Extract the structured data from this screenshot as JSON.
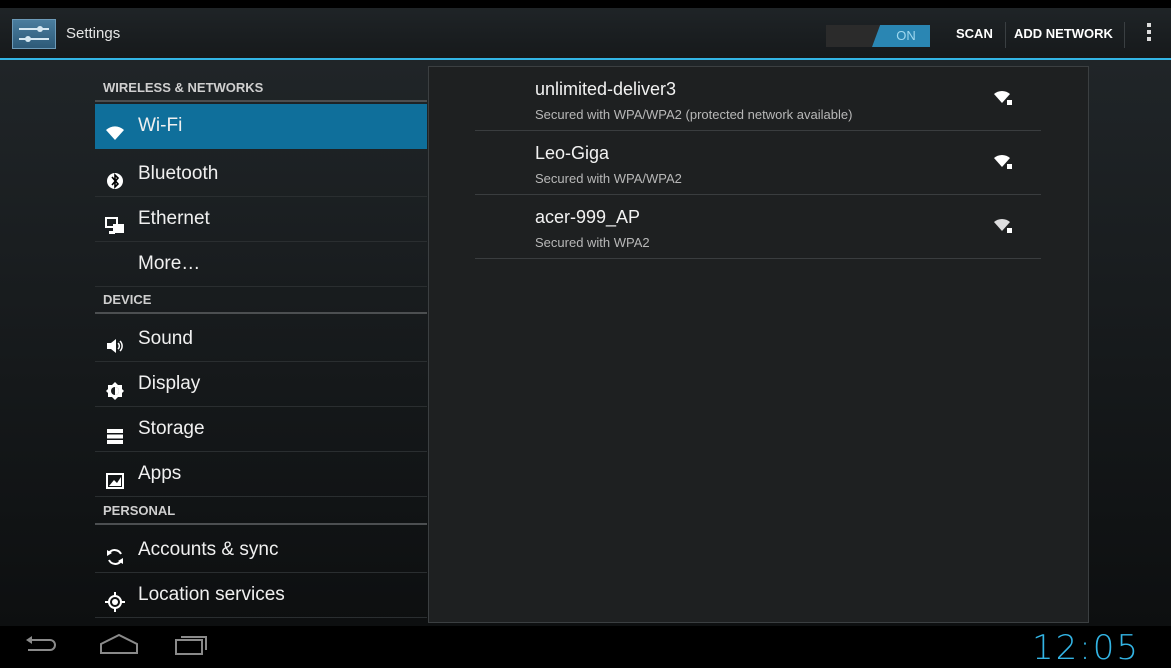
{
  "app": {
    "title": "Settings"
  },
  "actionbar": {
    "toggle_label": "ON",
    "scan_label": "SCAN",
    "add_network_label": "ADD NETWORK",
    "overflow_icon": "overflow-menu-icon",
    "accent": "#33b5e5"
  },
  "sidebar": {
    "sections": [
      {
        "title": "WIRELESS & NETWORKS"
      },
      {
        "title": "DEVICE"
      },
      {
        "title": "PERSONAL"
      }
    ],
    "items": [
      {
        "label": "Wi-Fi",
        "icon": "wifi-icon",
        "selected": true
      },
      {
        "label": "Bluetooth",
        "icon": "bluetooth-icon"
      },
      {
        "label": "Ethernet",
        "icon": "ethernet-icon"
      },
      {
        "label": "More…",
        "icon": ""
      },
      {
        "label": "Sound",
        "icon": "sound-icon"
      },
      {
        "label": "Display",
        "icon": "display-icon"
      },
      {
        "label": "Storage",
        "icon": "storage-icon"
      },
      {
        "label": "Apps",
        "icon": "apps-icon"
      },
      {
        "label": "Accounts & sync",
        "icon": "sync-icon"
      },
      {
        "label": "Location services",
        "icon": "location-icon"
      }
    ],
    "selected_color": "#0f6f9b"
  },
  "networks": [
    {
      "name": "unlimited-deliver3",
      "security": "Secured with WPA/WPA2 (protected network available)"
    },
    {
      "name": "Leo-Giga",
      "security": "Secured with WPA/WPA2"
    },
    {
      "name": "acer-999_AP",
      "security": "Secured with WPA2"
    }
  ],
  "navbar": {
    "back_icon": "back-icon",
    "home_icon": "home-icon",
    "recents_icon": "recent-apps-icon",
    "clock": "12:05"
  }
}
